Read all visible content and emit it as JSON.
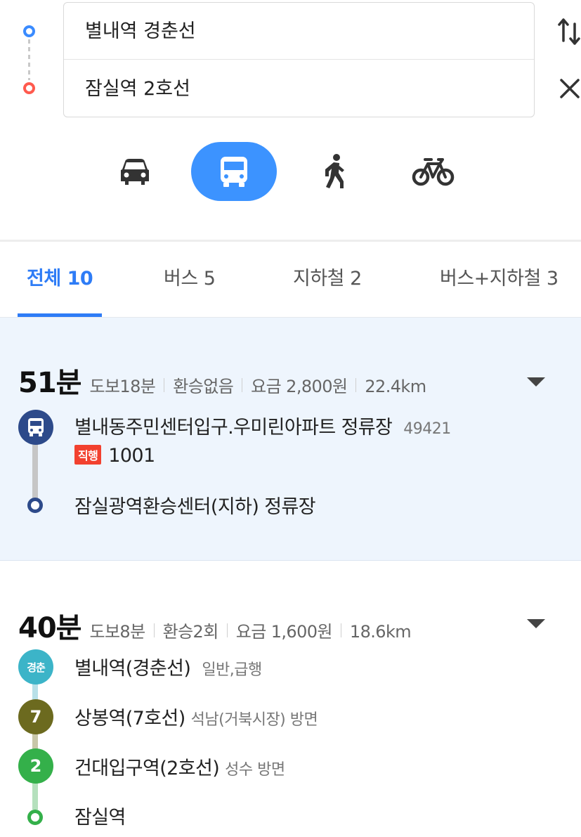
{
  "search": {
    "origin": "별내역 경춘선",
    "destination": "잠실역 2호선"
  },
  "modes": [
    {
      "name": "car",
      "icon": "car-icon",
      "active": false
    },
    {
      "name": "bus",
      "icon": "bus-icon",
      "active": true
    },
    {
      "name": "walk",
      "icon": "walking-icon",
      "active": false
    },
    {
      "name": "bike",
      "icon": "bicycle-icon",
      "active": false
    }
  ],
  "tabs": [
    {
      "label": "전체 10",
      "active": true
    },
    {
      "label": "버스 5",
      "active": false
    },
    {
      "label": "지하철 2",
      "active": false
    },
    {
      "label": "버스+지하철 3",
      "active": false
    }
  ],
  "colors": {
    "accent": "#2e7cf6",
    "mode_active": "#3c93ff",
    "origin_pin": "#3a8bff",
    "destination_pin": "#ff5a4e",
    "bus_badge": "#2d4a8a",
    "gyeongchun": "#3cb4c8",
    "line7": "#6c6a1f",
    "line2": "#34b04a",
    "express": "#f2412f"
  },
  "routes": [
    {
      "time": "51분",
      "walk": "도보18분",
      "transfer": "환승없음",
      "fare": "요금 2,800원",
      "distance": "22.4km",
      "legs": [
        {
          "icon": "bus-icon",
          "name": "별내동주민센터입구.우미린아파트 정류장",
          "sub": "49421"
        },
        {
          "tag": "직행",
          "bus_number": "1001"
        },
        {
          "name": "잠실광역환승센터(지하) 정류장"
        }
      ]
    },
    {
      "time": "40분",
      "walk": "도보8분",
      "transfer": "환승2회",
      "fare": "요금 1,600원",
      "distance": "18.6km",
      "legs": [
        {
          "badge": "경춘",
          "name": "별내역(경춘선)",
          "sub": "일반,급행"
        },
        {
          "badge": "7",
          "name": "상봉역(7호선)",
          "sub": "석남(거북시장) 방면"
        },
        {
          "badge": "2",
          "name": "건대입구역(2호선)",
          "sub": "성수 방면"
        },
        {
          "name": "잠실역"
        }
      ]
    }
  ]
}
